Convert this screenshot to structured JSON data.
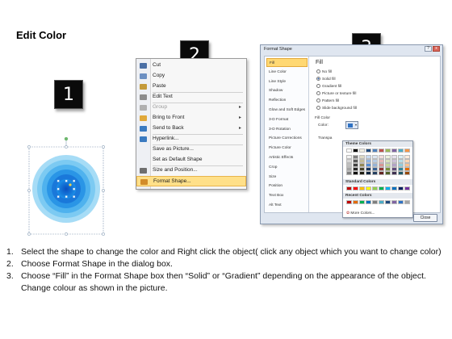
{
  "title": "Edit Color",
  "step_numbers": [
    "1",
    "2",
    "3"
  ],
  "context_menu": {
    "items": [
      {
        "label": "Cut",
        "icon": "scissors-icon",
        "disabled": false,
        "submenu": false
      },
      {
        "label": "Copy",
        "icon": "copy-icon",
        "disabled": false,
        "submenu": false
      },
      {
        "label": "Paste",
        "icon": "paste-icon",
        "disabled": false,
        "submenu": false
      },
      {
        "label": "Edit Text",
        "icon": "edit-text-icon",
        "disabled": false,
        "submenu": false
      },
      {
        "label": "Group",
        "icon": "group-icon",
        "disabled": true,
        "submenu": true
      },
      {
        "label": "Bring to Front",
        "icon": "bring-to-front-icon",
        "disabled": false,
        "submenu": true
      },
      {
        "label": "Send to Back",
        "icon": "send-to-back-icon",
        "disabled": false,
        "submenu": true
      },
      {
        "label": "Hyperlink...",
        "icon": "hyperlink-icon",
        "disabled": false,
        "submenu": false
      },
      {
        "label": "Save as Picture...",
        "icon": "",
        "disabled": false,
        "submenu": false
      },
      {
        "label": "Set as Default Shape",
        "icon": "",
        "disabled": false,
        "submenu": false
      },
      {
        "label": "Size and Position...",
        "icon": "size-position-icon",
        "disabled": false,
        "submenu": false
      },
      {
        "label": "Format Shape...",
        "icon": "format-shape-icon",
        "disabled": false,
        "submenu": false,
        "active": true
      }
    ]
  },
  "dialog": {
    "title": "Format Shape",
    "window_buttons": [
      "?",
      "x"
    ],
    "nav": [
      "Fill",
      "Line Color",
      "Line Style",
      "Shadow",
      "Reflection",
      "Glow and Soft Edges",
      "3-D Format",
      "3-D Rotation",
      "Picture Corrections",
      "Picture Color",
      "Artistic Effects",
      "Crop",
      "Size",
      "Position",
      "Text Box",
      "Alt Text"
    ],
    "nav_active": "Fill",
    "fill_heading": "Fill",
    "options": [
      "No fill",
      "Solid fill",
      "Gradient fill",
      "Picture or texture fill",
      "Pattern fill",
      "Slide background fill"
    ],
    "selected_option": "Solid fill",
    "fill_color_label": "Fill Color",
    "color_label": "Color:",
    "transparency_label": "Transpa",
    "palette": {
      "theme_label": "Theme Colors",
      "standard_label": "Standard Colors",
      "recent_label": "Recent Colors",
      "more_label": "More Colors...",
      "theme_top": [
        "#ffffff",
        "#000000",
        "#eeece1",
        "#1f497d",
        "#4f81bd",
        "#c0504d",
        "#9bbb59",
        "#8064a2",
        "#4bacc6",
        "#f79646"
      ],
      "theme_shades": [
        [
          "#f2f2f2",
          "#7f7f7f",
          "#ddd9c3",
          "#c6d9f0",
          "#dbe5f1",
          "#f2dcdb",
          "#ebf1dd",
          "#e5e0ec",
          "#dbeef3",
          "#fdeada"
        ],
        [
          "#d8d8d8",
          "#595959",
          "#c4bd97",
          "#8db3e2",
          "#b8cce4",
          "#e5b9b7",
          "#d7e3bc",
          "#ccc1d9",
          "#b7dde8",
          "#fbd5b5"
        ],
        [
          "#bfbfbf",
          "#3f3f3f",
          "#938953",
          "#548dd4",
          "#95b3d7",
          "#d99694",
          "#c3d69b",
          "#b2a2c7",
          "#92cddc",
          "#fac08f"
        ],
        [
          "#a5a5a5",
          "#262626",
          "#494429",
          "#17365d",
          "#366092",
          "#953734",
          "#76923c",
          "#5f497a",
          "#31859b",
          "#e36c09"
        ],
        [
          "#7f7f7f",
          "#0c0c0c",
          "#1d1b10",
          "#0f243e",
          "#244061",
          "#632423",
          "#4f6128",
          "#3f3151",
          "#205867",
          "#974806"
        ]
      ],
      "standard": [
        "#c00000",
        "#ff0000",
        "#ffc000",
        "#ffff00",
        "#92d050",
        "#00b050",
        "#00b0f0",
        "#0070c0",
        "#002060",
        "#7030a0"
      ],
      "recent": [
        "#c00000",
        "#e46c0a",
        "#00b050",
        "#0070c0",
        "#7f7f7f",
        "#4bacc6",
        "#1f497d",
        "#8064a2",
        "#2f72c4",
        "#a5a5a5"
      ]
    },
    "close_label": "Close"
  },
  "instructions": [
    {
      "num": "1.",
      "text": "Select the shape to change the color and Right click the object( click any object which you want to change color)"
    },
    {
      "num": "2.",
      "text": "Choose Format Shape in the dialog box."
    },
    {
      "num": "3.",
      "text": "Choose “Fill” in the Format Shape box then “Solid” or “Gradient” depending on the appearance of the object. Change colour as shown in the picture."
    }
  ],
  "colors": {
    "shape_outer": "#9fd8f5",
    "shape_inner": "#0a5fcc",
    "selection_handle": "#6fb86f",
    "step_box": "#0a0a0a",
    "menu_highlight": "#ffe089"
  }
}
